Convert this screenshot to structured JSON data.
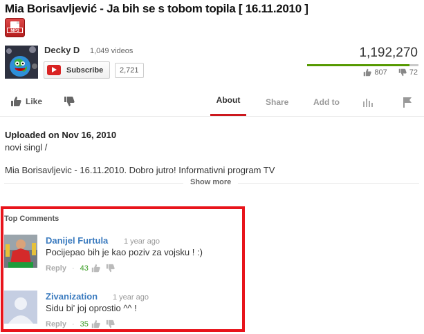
{
  "video": {
    "title": "Mia Borisavljević - Ja bih se s tobom topila [ 16.11.2010 ]",
    "format_badge": "MP3"
  },
  "channel": {
    "name": "Decky D",
    "video_count": "1,049 videos",
    "subscribe_label": "Subscribe",
    "subscriber_count": "2,721"
  },
  "stats": {
    "views": "1,192,270",
    "likes": "807",
    "dislikes": "72",
    "like_ratio": 0.918
  },
  "actions": {
    "like_label": "Like",
    "tabs": {
      "about": "About",
      "share": "Share",
      "add_to": "Add to"
    }
  },
  "about": {
    "uploaded": "Uploaded on Nov 16, 2010",
    "line1": "novi singl /",
    "line2": "Mia Borisavljevic - 16.11.2010. Dobro jutro! Informativni program TV",
    "show_more": "Show more"
  },
  "comments": {
    "title": "Top Comments",
    "items": [
      {
        "author": "Danijel Furtula",
        "time": "1 year ago",
        "text": "Pocijepao bih je kao poziv za vojsku ! :)",
        "reply": "Reply",
        "dot": "·",
        "votes": "43"
      },
      {
        "author": "Zivanization",
        "time": "1 year ago",
        "text": "Sidu bi' joj oprostio ^^ !",
        "reply": "Reply",
        "dot": "·",
        "votes": "35"
      }
    ]
  },
  "colors": {
    "accent_red": "#cc181e",
    "highlight_box": "#e8141b",
    "link_blue": "#3b7bbf",
    "vote_green": "#3a9d23",
    "like_bar_green": "#559900"
  }
}
